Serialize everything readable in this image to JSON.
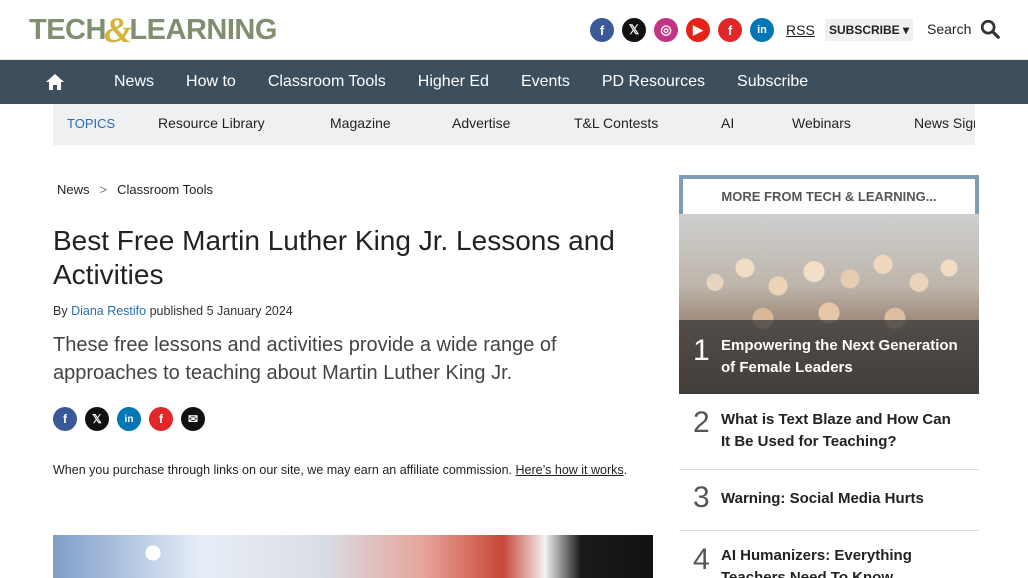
{
  "header": {
    "logo_text_1": "TECH",
    "logo_amp": "&",
    "logo_text_2": "LEARNING",
    "social": [
      {
        "name": "facebook",
        "glyph": "f"
      },
      {
        "name": "x",
        "glyph": "𝕏"
      },
      {
        "name": "instagram",
        "glyph": "◎"
      },
      {
        "name": "youtube",
        "glyph": "▶"
      },
      {
        "name": "flipboard",
        "glyph": "f"
      },
      {
        "name": "linkedin",
        "glyph": "in"
      }
    ],
    "rss_label": "RSS",
    "subscribe_label": "SUBSCRIBE ▾",
    "search_label": "Search"
  },
  "nav": {
    "items": [
      "News",
      "How to",
      "Classroom Tools",
      "Higher Ed",
      "Events",
      "PD Resources",
      "Subscribe"
    ]
  },
  "topics": {
    "label": "TOPICS",
    "items": [
      "Resource Library",
      "Magazine",
      "Advertise",
      "T&L Contests",
      "AI",
      "Webinars",
      "News Sign"
    ]
  },
  "breadcrumb": {
    "items": [
      "News",
      "Classroom Tools"
    ],
    "separator": ">"
  },
  "article": {
    "title": "Best Free Martin Luther King Jr. Lessons and Activities",
    "by_prefix": "By ",
    "author": "Diana Restifo",
    "published_text": " published 5 January 2024",
    "description": "These free lessons and activities provide a wide range of approaches to teaching about Martin Luther King Jr.",
    "share": [
      {
        "name": "facebook",
        "glyph": "f"
      },
      {
        "name": "x",
        "glyph": "𝕏"
      },
      {
        "name": "linkedin",
        "glyph": "in"
      },
      {
        "name": "flipboard",
        "glyph": "f"
      },
      {
        "name": "email",
        "glyph": "✉"
      }
    ],
    "affiliate_text": "When you purchase through links on our site, we may earn an affiliate commission. ",
    "affiliate_link": "Here’s how it works",
    "affiliate_end": "."
  },
  "sidebar": {
    "heading": "MORE FROM TECH & LEARNING...",
    "items": [
      {
        "num": "1",
        "title": "Empowering the Next Generation of Female Leaders"
      },
      {
        "num": "2",
        "title": "What is Text Blaze and How Can It Be Used for Teaching?"
      },
      {
        "num": "3",
        "title": "Warning: Social Media Hurts"
      },
      {
        "num": "4",
        "title": "AI Humanizers: Everything Teachers Need To Know"
      }
    ]
  }
}
